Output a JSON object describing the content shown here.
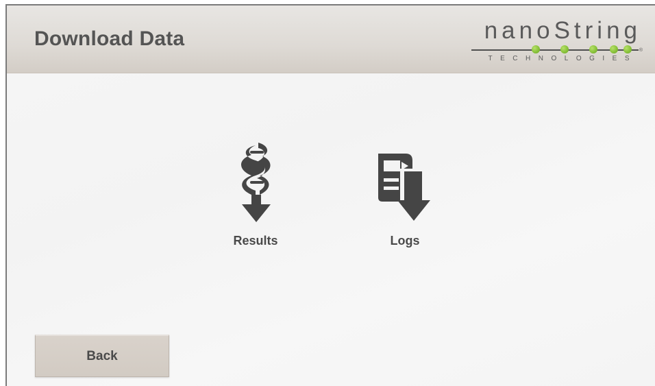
{
  "header": {
    "title": "Download Data",
    "logo": {
      "wordmark": "nanoString",
      "subtitle": "TECHNOLOGIES",
      "registered": "®",
      "dot_color": "#88c23a"
    }
  },
  "main": {
    "options": [
      {
        "label": "Results",
        "icon": "dna-download-icon"
      },
      {
        "label": "Logs",
        "icon": "document-download-icon"
      }
    ]
  },
  "footer": {
    "back_label": "Back"
  },
  "colors": {
    "header_bg": "#dedad5",
    "text": "#545454",
    "button_bg": "#d5cec6",
    "icon": "#454545"
  }
}
